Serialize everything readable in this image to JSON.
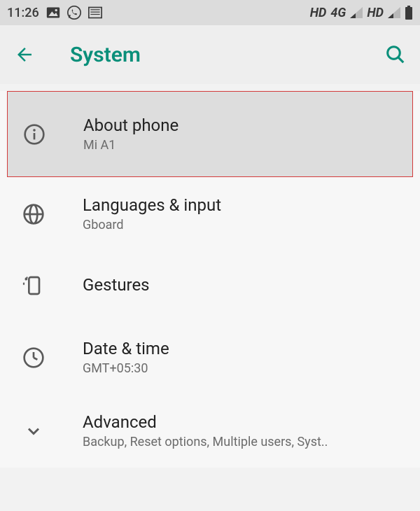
{
  "status_bar": {
    "time": "11:26",
    "hd1": "HD",
    "net": "4G",
    "hd2": "HD"
  },
  "app_bar": {
    "title": "System"
  },
  "items": {
    "about": {
      "title": "About phone",
      "subtitle": "Mi A1"
    },
    "lang": {
      "title": "Languages & input",
      "subtitle": "Gboard"
    },
    "gestures": {
      "title": "Gestures"
    },
    "datetime": {
      "title": "Date & time",
      "subtitle": "GMT+05:30"
    },
    "advanced": {
      "title": "Advanced",
      "subtitle": "Backup, Reset options, Multiple users, Syst.."
    }
  }
}
